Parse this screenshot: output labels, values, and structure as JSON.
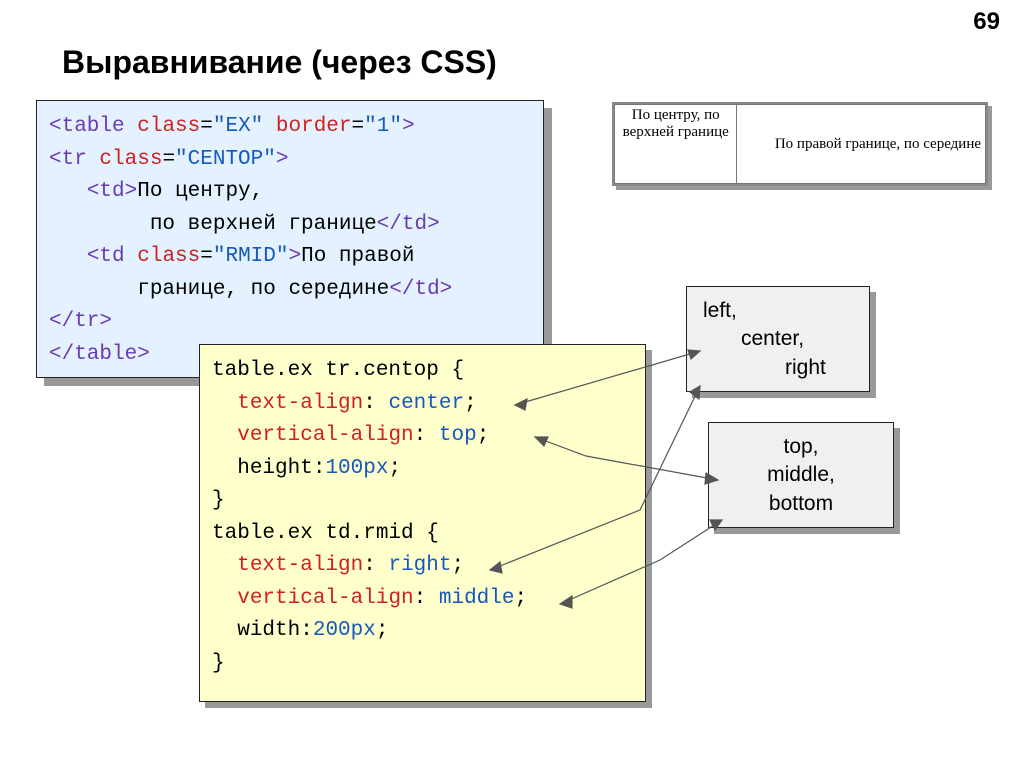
{
  "page_number": "69",
  "title": "Выравнивание (через CSS)",
  "html_code": {
    "l1a": "<table",
    "l1b": "class",
    "l1c": "\"EX\"",
    "l1d": "border",
    "l1e": "\"1\"",
    "l1f": ">",
    "l2a": "<tr",
    "l2b": "class",
    "l2c": "\"CENTOP\"",
    "l2d": ">",
    "l3a": "<td>",
    "l3b": "По центру,",
    "l4a": "по верхней границе",
    "l4b": "</td>",
    "l5a": "<td",
    "l5b": "class",
    "l5c": "\"RMID\"",
    "l5d": ">",
    "l5e": "По правой",
    "l6a": "границе, по середине",
    "l6b": "</td>",
    "l7": "</tr>",
    "l8": "</table>"
  },
  "css_code": {
    "r1": "table.ex tr.centop {",
    "r2a": "text-align",
    "r2b": "center",
    "r3a": "vertical-align",
    "r3b": "top",
    "r4a": "height",
    "r4b": "100px",
    "r5": "}",
    "r6": "table.ex td.rmid {",
    "r7a": "text-align",
    "r7b": "right",
    "r8a": "vertical-align",
    "r8b": "middle",
    "r9a": "width",
    "r9b": "200px",
    "r10": "}"
  },
  "example": {
    "cell1": "По центру, по верхней границе",
    "cell2": "По правой границе, по середине"
  },
  "label1": {
    "l1": "left,",
    "l2": "center,",
    "l3": "right"
  },
  "label2": {
    "l1": "top,",
    "l2": "middle,",
    "l3": "bottom"
  }
}
